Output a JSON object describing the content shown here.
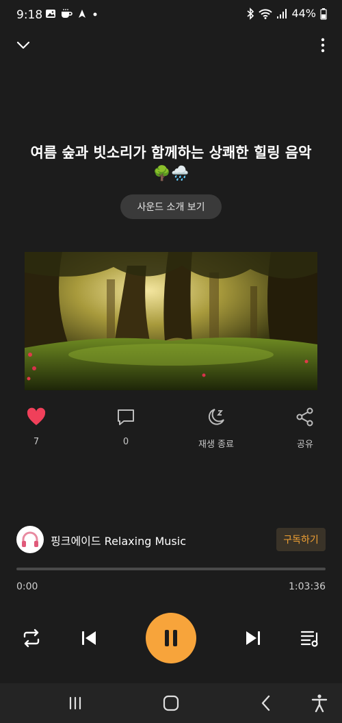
{
  "status_bar": {
    "time": "9:18",
    "battery": "44%"
  },
  "track": {
    "title": "여름 숲과 빗소리가 함께하는 상쾌한 힐링 음악🌳🌧️",
    "intro_button": "사운드 소개 보기"
  },
  "actions": {
    "like_count": "7",
    "comment_count": "0",
    "sleep_timer_label": "재생 종료",
    "share_label": "공유"
  },
  "channel": {
    "name": "핑크에이드 Relaxing Music",
    "subscribe_label": "구독하기"
  },
  "player": {
    "current_time": "0:00",
    "total_time": "1:03:36",
    "progress": 0,
    "state": "playing"
  },
  "colors": {
    "accent": "#f7a43b",
    "like": "#f0405a",
    "background": "#1c1c1c"
  }
}
